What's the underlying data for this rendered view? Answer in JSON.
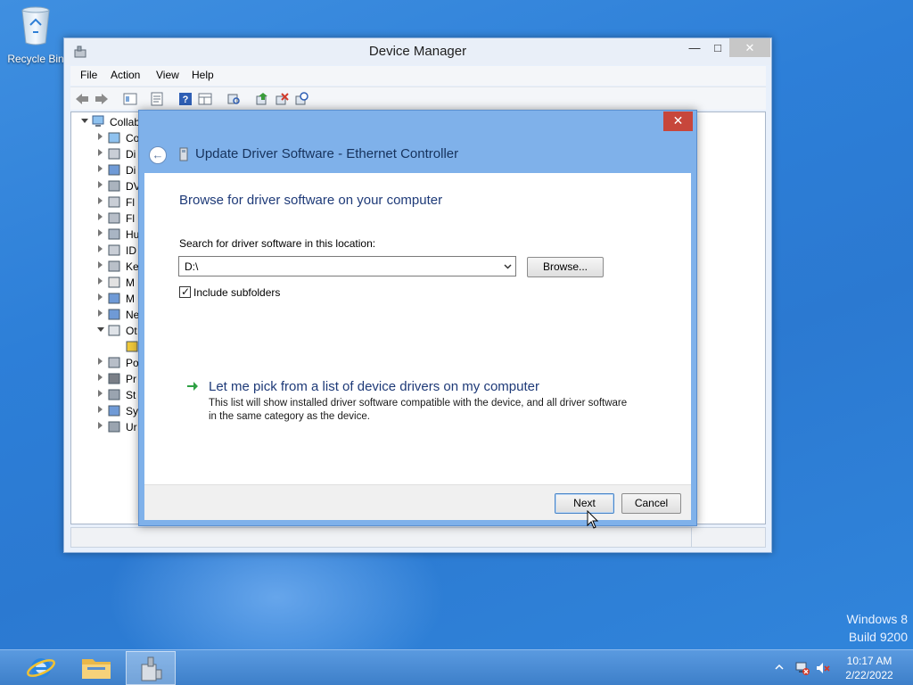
{
  "desktop": {
    "recycle_bin_label": "Recycle Bin",
    "watermark_line1": "Windows 8",
    "watermark_line2": "Build 9200"
  },
  "window": {
    "title": "Device Manager",
    "menu": [
      "File",
      "Action",
      "View",
      "Help"
    ],
    "tree_root": "Collab",
    "tree_items": [
      "Co",
      "Di",
      "Di",
      "DV",
      "Fl",
      "Fl",
      "Hu",
      "ID",
      "Ke",
      "M",
      "M",
      "Ne",
      "Ot",
      "",
      "Po",
      "Pr",
      "St",
      "Sy",
      "Ur"
    ]
  },
  "dialog": {
    "title": "Update Driver Software - Ethernet Controller",
    "heading": "Browse for driver software on your computer",
    "search_label": "Search for driver software in this location:",
    "path_value": "D:\\",
    "browse_label": "Browse...",
    "include_subfolders_label": "Include subfolders",
    "include_subfolders_checked": true,
    "pick_title": "Let me pick from a list of device drivers on my computer",
    "pick_description": "This list will show installed driver software compatible with the device, and all driver software in the same category as the device.",
    "next_label": "Next",
    "cancel_label": "Cancel"
  },
  "taskbar": {
    "apps": [
      "internet-explorer",
      "file-explorer",
      "device-manager"
    ],
    "active_app": "device-manager",
    "clock_time": "10:17 AM",
    "clock_date": "2/22/2022"
  }
}
